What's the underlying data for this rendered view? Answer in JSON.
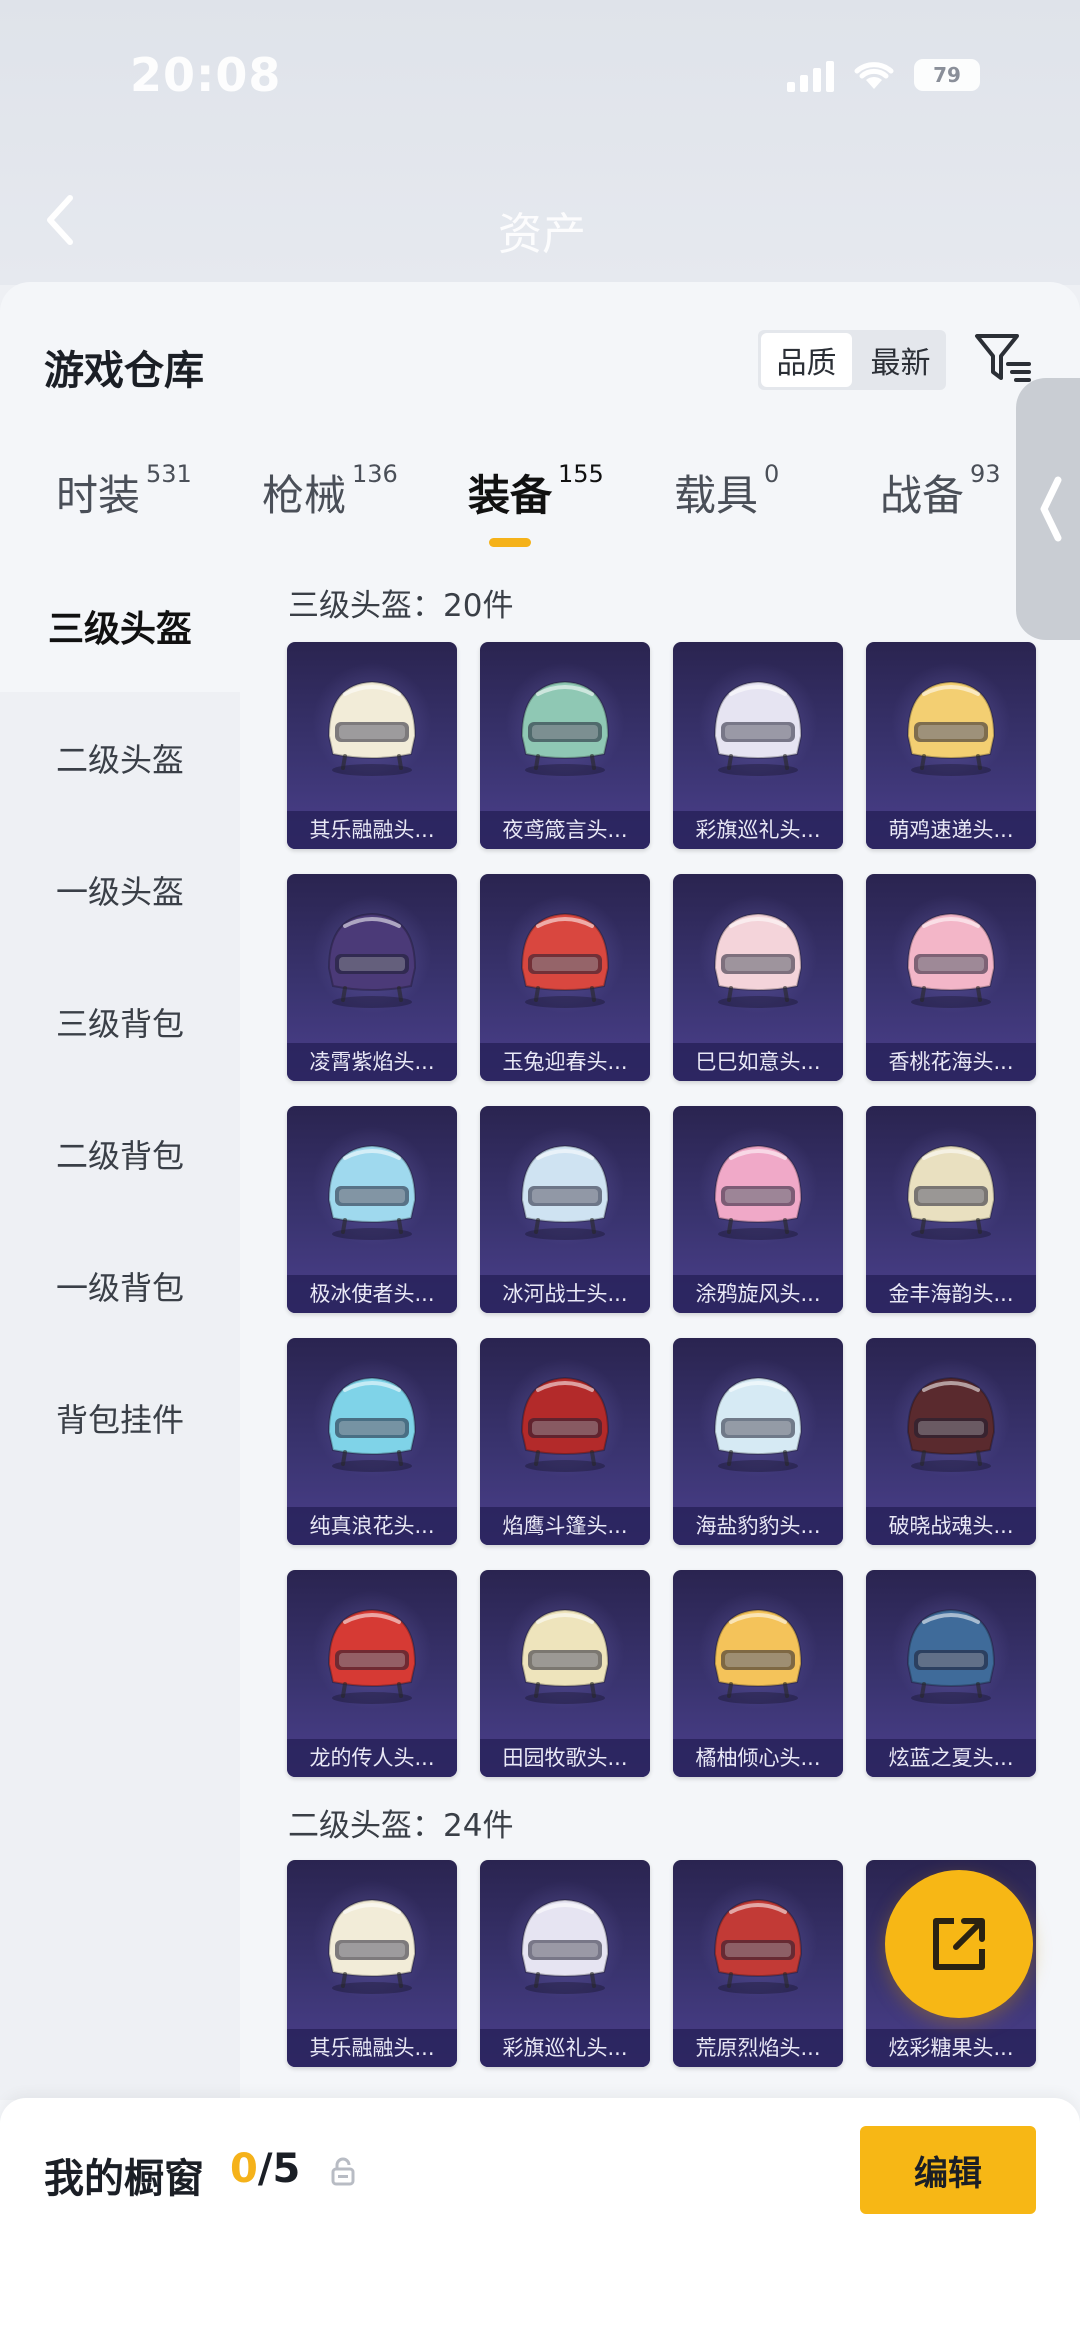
{
  "status_bar": {
    "time": "20:08",
    "battery": "79"
  },
  "header": {
    "title": "资产"
  },
  "sheet": {
    "title": "游戏仓库",
    "sort": {
      "quality": "品质",
      "newest": "最新"
    }
  },
  "tabs": [
    {
      "label": "时装",
      "count": "531"
    },
    {
      "label": "枪械",
      "count": "136"
    },
    {
      "label": "装备",
      "count": "155"
    },
    {
      "label": "载具",
      "count": "0"
    },
    {
      "label": "战备",
      "count": "93"
    }
  ],
  "sidebar": [
    "三级头盔",
    "二级头盔",
    "一级头盔",
    "三级背包",
    "二级背包",
    "一级背包",
    "背包挂件"
  ],
  "sections": [
    {
      "title": "三级头盔：20件",
      "items": [
        {
          "name": "其乐融融头...",
          "color": "#f2ecd8"
        },
        {
          "name": "夜鸢箴言头...",
          "color": "#8fc8b4"
        },
        {
          "name": "彩旗巡礼头...",
          "color": "#e6e4f2"
        },
        {
          "name": "萌鸡速递头...",
          "color": "#f3cf72"
        },
        {
          "name": "凌霄紫焰头...",
          "color": "#4b3a78"
        },
        {
          "name": "玉兔迎春头...",
          "color": "#d9473f"
        },
        {
          "name": "巳巳如意头...",
          "color": "#f4d4da"
        },
        {
          "name": "香桃花海头...",
          "color": "#f3b6c8"
        },
        {
          "name": "极冰使者头...",
          "color": "#9fd9ee"
        },
        {
          "name": "冰河战士头...",
          "color": "#cfe3f2"
        },
        {
          "name": "涂鸦旋风头...",
          "color": "#f0a9c8"
        },
        {
          "name": "金丰海韵头...",
          "color": "#e9e0c0"
        },
        {
          "name": "纯真浪花头...",
          "color": "#7fd3e8"
        },
        {
          "name": "焰鹰斗篷头...",
          "color": "#b32a2a"
        },
        {
          "name": "海盐豹豹头...",
          "color": "#d6eaf4"
        },
        {
          "name": "破晓战魂头...",
          "color": "#5a2a2e"
        },
        {
          "name": "龙的传人头...",
          "color": "#d63a34"
        },
        {
          "name": "田园牧歌头...",
          "color": "#eee4bc"
        },
        {
          "name": "橘柚倾心头...",
          "color": "#f4c35a"
        },
        {
          "name": "炫蓝之夏头...",
          "color": "#3f6b9a"
        }
      ]
    },
    {
      "title": "二级头盔：24件",
      "items": [
        {
          "name": "其乐融融头...",
          "color": "#f2ecd8"
        },
        {
          "name": "彩旗巡礼头...",
          "color": "#e6e4f2"
        },
        {
          "name": "荒原烈焰头...",
          "color": "#c23a36"
        },
        {
          "name": "炫彩糖果头...",
          "color": "#f0a0c4"
        }
      ]
    }
  ],
  "shelf": {
    "title": "我的橱窗",
    "current": "0",
    "total": "/5"
  },
  "edit_button": "编辑",
  "colors": {
    "accent": "#f7b715",
    "card_bg": "#3a3470"
  }
}
